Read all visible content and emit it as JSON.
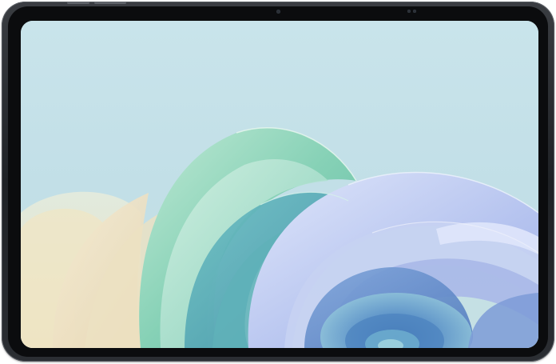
{
  "device": {
    "type": "tablet",
    "orientation": "landscape",
    "frame_color": "#2b2e33",
    "bezel_color": "#0b0c0e",
    "sensors": [
      "front-camera-icon",
      "ambient-sensor-icon"
    ]
  },
  "screen": {
    "state": "wallpaper",
    "wallpaper": {
      "style": "abstract-swirl-bloom",
      "sky_color": "#c8e3ea",
      "palette": {
        "green": "#8fd4b8",
        "mint": "#a9e2cf",
        "teal": "#4fa7b5",
        "blue": "#5b86c7",
        "lavender": "#aab7e6",
        "cream": "#eee6c6",
        "peach": "#f0dcb8"
      }
    }
  }
}
